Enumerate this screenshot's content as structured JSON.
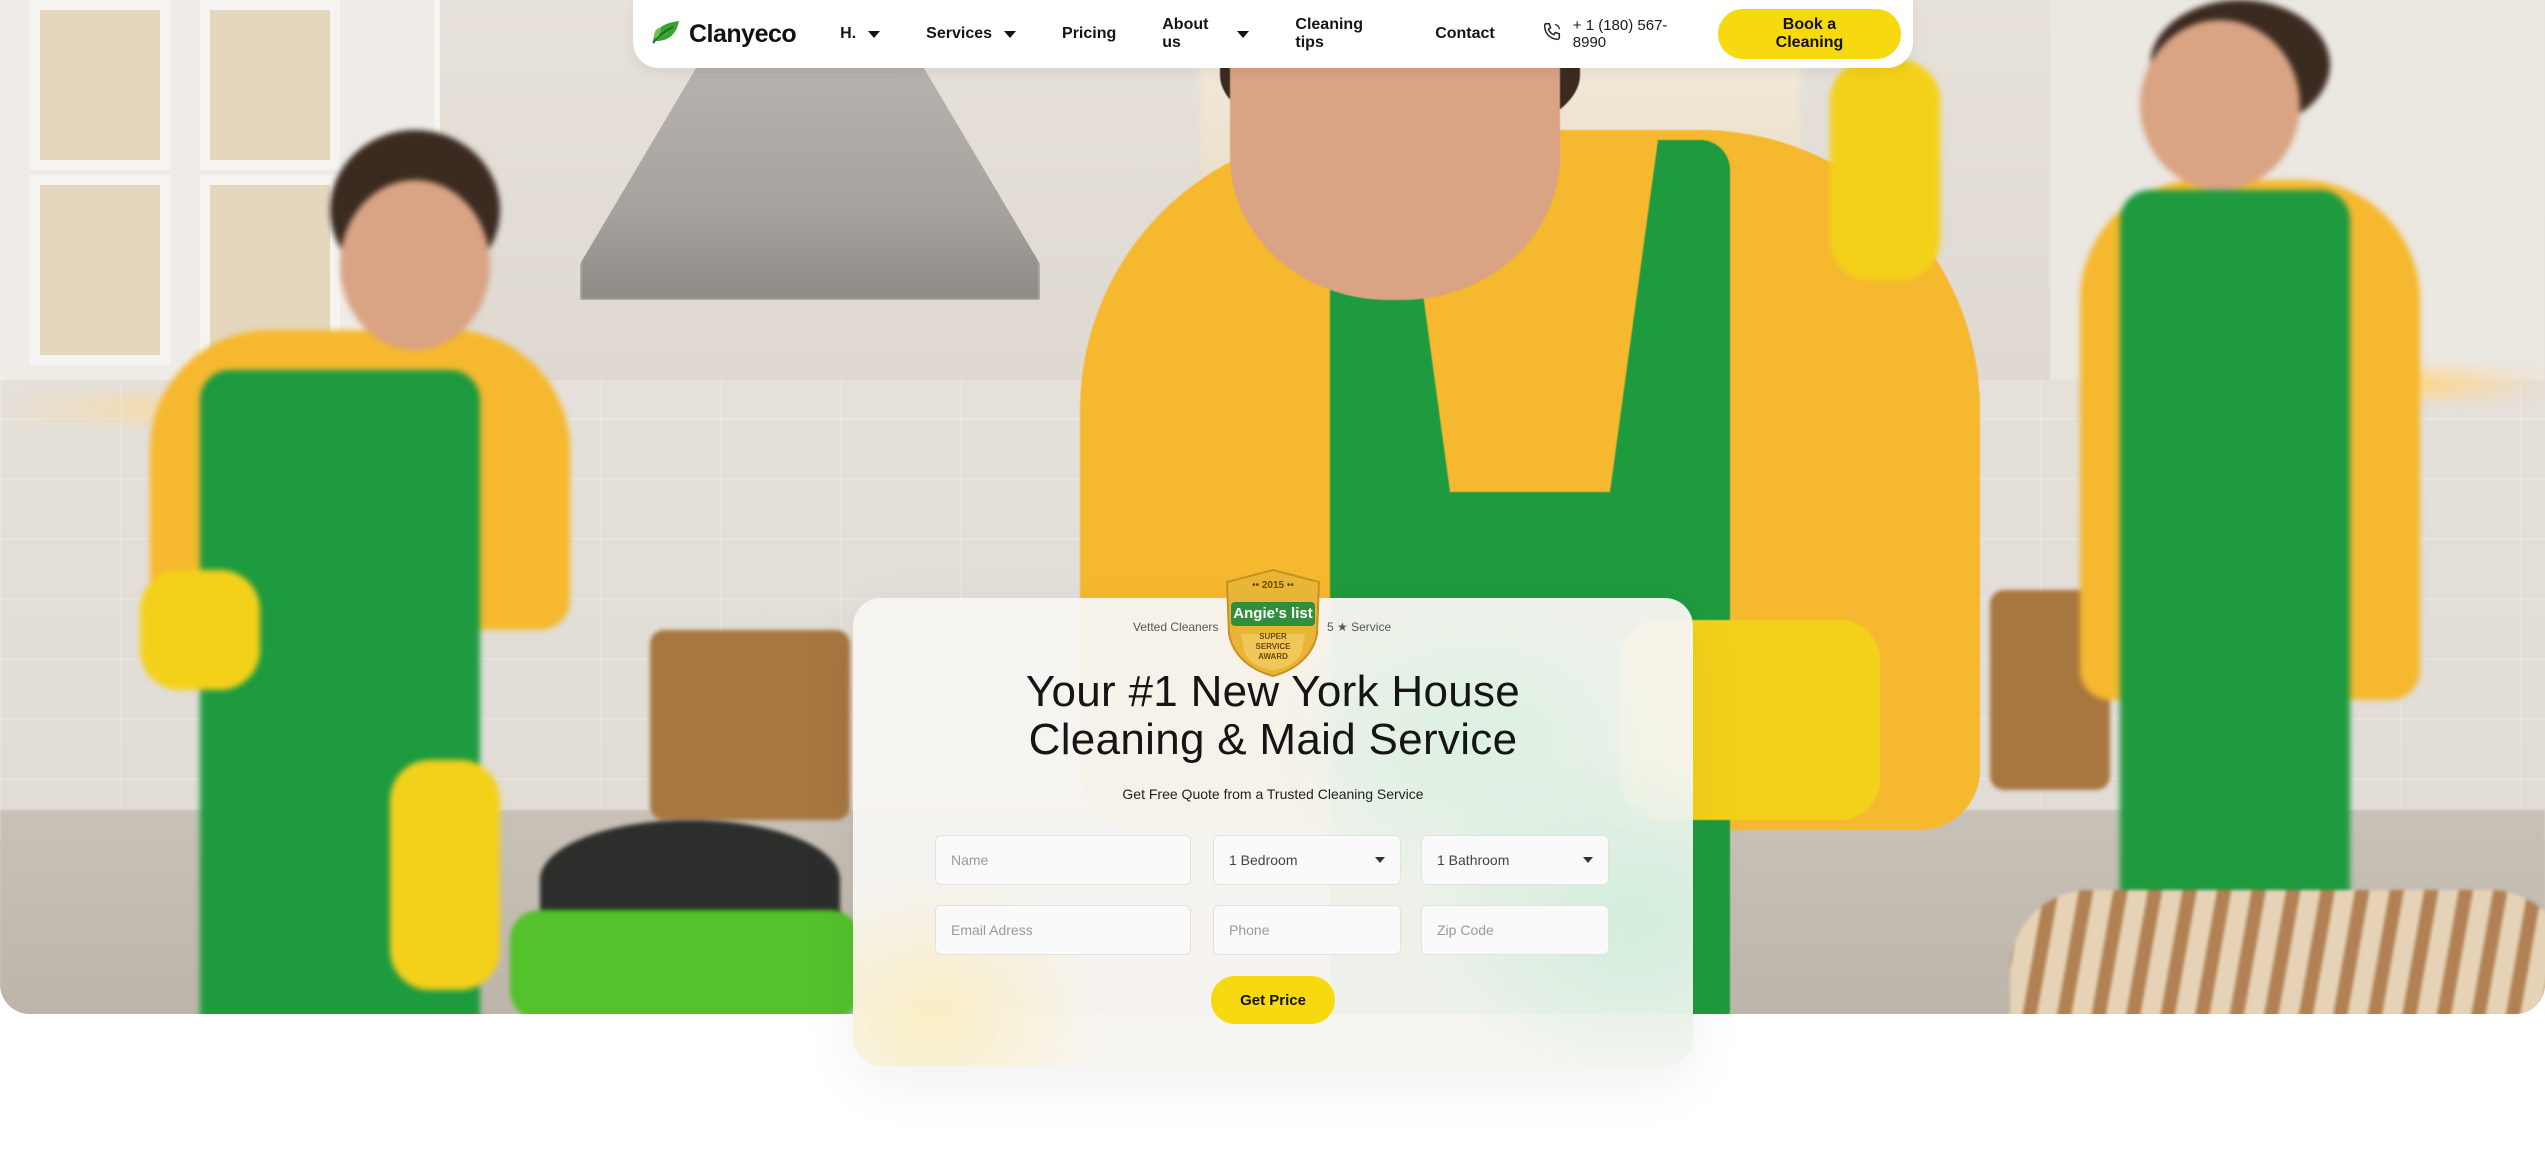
{
  "header": {
    "brand": {
      "name": "Clanyeco",
      "icon": "leaf-icon",
      "color": "#3aa336"
    },
    "nav": [
      {
        "label": "H.",
        "has_dropdown": true
      },
      {
        "label": "Services",
        "has_dropdown": true
      },
      {
        "label": "Pricing",
        "has_dropdown": false
      },
      {
        "label": "About us",
        "has_dropdown": true
      },
      {
        "label": "Cleaning tips",
        "has_dropdown": false
      },
      {
        "label": "Contact",
        "has_dropdown": false
      }
    ],
    "phone": {
      "icon": "phone-icon",
      "number": "+ 1 (180) 567-8990"
    },
    "cta_label": "Book a Cleaning"
  },
  "quote": {
    "badge": {
      "left_text": "Vetted Cleaners",
      "right_text": "5 ★ Service",
      "year": "•• 2015 ••",
      "name": "Angie's list",
      "award_line1": "SUPER",
      "award_line2": "SERVICE",
      "award_line3": "AWARD"
    },
    "title_line1": "Your #1 New York House",
    "title_line2": "Cleaning & Maid Service",
    "subtitle": "Get Free Quote from a Trusted Cleaning Service",
    "fields": {
      "name_placeholder": "Name",
      "bedroom_value": "1 Bedroom",
      "bathroom_value": "1 Bathroom",
      "email_placeholder": "Email Adress",
      "phone_placeholder": "Phone",
      "zip_placeholder": "Zip Code"
    },
    "submit_label": "Get Price"
  },
  "colors": {
    "accent_yellow": "#f6d90f",
    "brand_green": "#3aa336",
    "text_dark": "#151515"
  }
}
